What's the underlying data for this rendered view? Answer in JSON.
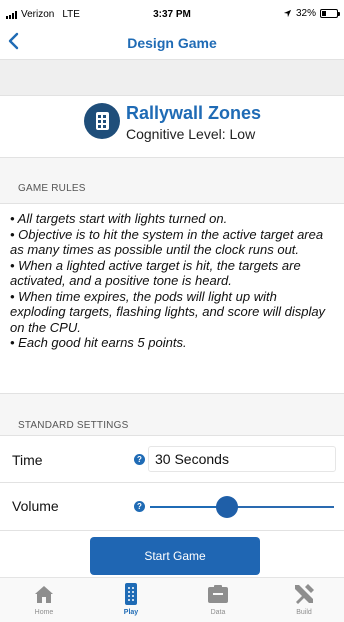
{
  "status_bar": {
    "carrier": "Verizon",
    "network": "LTE",
    "time": "3:37 PM",
    "battery": "32%",
    "battery_level": 0.32
  },
  "nav": {
    "title": "Design Game",
    "back_icon": "chevron-left-icon"
  },
  "game": {
    "name": "Rallywall Zones",
    "level": "Cognitive Level: Low",
    "icon": "rallywall-icon"
  },
  "rules": {
    "label": "GAME RULES",
    "items": [
      "• All targets start with lights turned on.",
      "• Objective is to hit the system in the active target area as many times as possible until the clock runs out.",
      "• When a lighted active target is hit, the targets are activated, and a positive tone is heard.",
      "• When time expires, the pods will light up with exploding targets, flashing lights, and score will display on the CPU.",
      "• Each good hit earns 5 points."
    ]
  },
  "settings": {
    "label": "STANDARD SETTINGS",
    "time": {
      "label": "Time",
      "value": "30 Seconds",
      "help": "?"
    },
    "volume": {
      "label": "Volume",
      "help": "?",
      "level": 0.42
    }
  },
  "actions": {
    "start_label": "Start Game"
  },
  "tabs": [
    {
      "label": "Home",
      "icon": "home-icon",
      "active": false
    },
    {
      "label": "Play",
      "icon": "play-icon",
      "active": true
    },
    {
      "label": "Data",
      "icon": "data-icon",
      "active": false
    },
    {
      "label": "Build",
      "icon": "build-icon",
      "active": false
    }
  ],
  "colors": {
    "accent": "#1f6bb5",
    "badge": "#1f4e7a"
  }
}
